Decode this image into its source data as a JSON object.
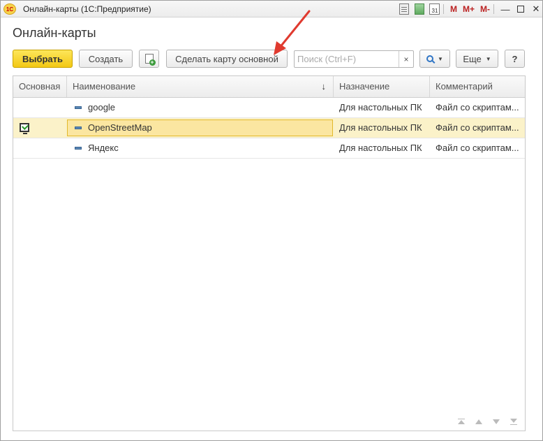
{
  "window": {
    "title": "Онлайн-карты  (1С:Предприятие)",
    "logo_text": "1С",
    "calendar_day": "31",
    "m_labels": [
      "M",
      "M+",
      "M-"
    ],
    "minimize": "—",
    "close": "✕"
  },
  "page": {
    "title": "Онлайн-карты"
  },
  "toolbar": {
    "select_label": "Выбрать",
    "create_label": "Создать",
    "make_main_label": "Сделать карту основной",
    "search_placeholder": "Поиск (Ctrl+F)",
    "search_clear": "×",
    "more_label": "Еще",
    "help_label": "?"
  },
  "table": {
    "columns": [
      "Основная",
      "Наименование",
      "Назначение",
      "Комментарий"
    ],
    "sort_indicator": "↓",
    "rows": [
      {
        "main": false,
        "name": "google",
        "purpose": "Для настольных ПК",
        "comment": "Файл со скриптам..."
      },
      {
        "main": true,
        "name": "OpenStreetMap",
        "purpose": "Для настольных ПК",
        "comment": "Файл со скриптам..."
      },
      {
        "main": false,
        "name": "Яндекс",
        "purpose": "Для настольных ПК",
        "comment": "Файл со скриптам..."
      }
    ],
    "selected_row": 1
  },
  "colors": {
    "primary_button": "#f3c814",
    "selected_row": "#fbf2c9",
    "annotation_arrow": "#e03a2f"
  }
}
